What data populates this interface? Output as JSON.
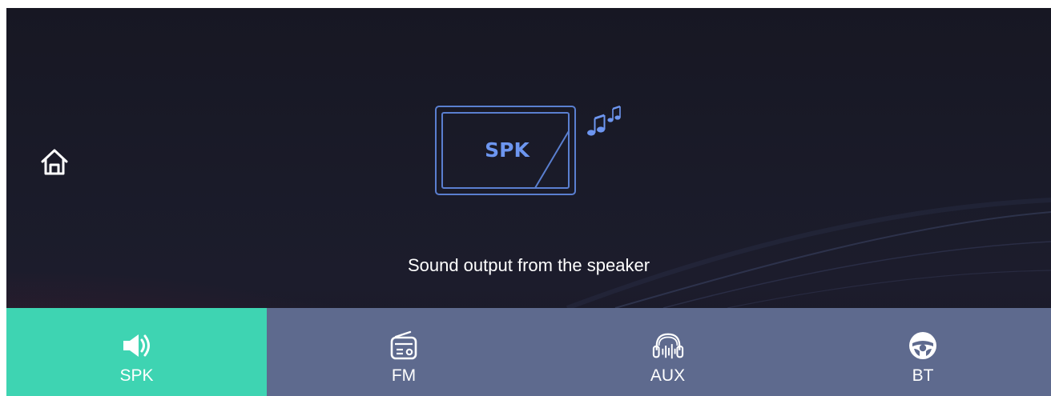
{
  "screen": {
    "icons": {
      "home": "home-icon",
      "device": "speaker-device-icon",
      "notes": "music-notes-icon"
    },
    "device_label": "SPK",
    "caption": "Sound output from the speaker"
  },
  "tabs": [
    {
      "label": "SPK",
      "icon": "speaker-icon",
      "active": true
    },
    {
      "label": "FM",
      "icon": "radio-icon",
      "active": false
    },
    {
      "label": "AUX",
      "icon": "headphones-icon",
      "active": false
    },
    {
      "label": "BT",
      "icon": "steering-wheel-icon",
      "active": false
    }
  ],
  "colors": {
    "active_tab": "#3ed4b2",
    "tab_bar": "#5e6a8e",
    "accent_blue": "#5a7fd0",
    "background": "#1a1b29"
  }
}
